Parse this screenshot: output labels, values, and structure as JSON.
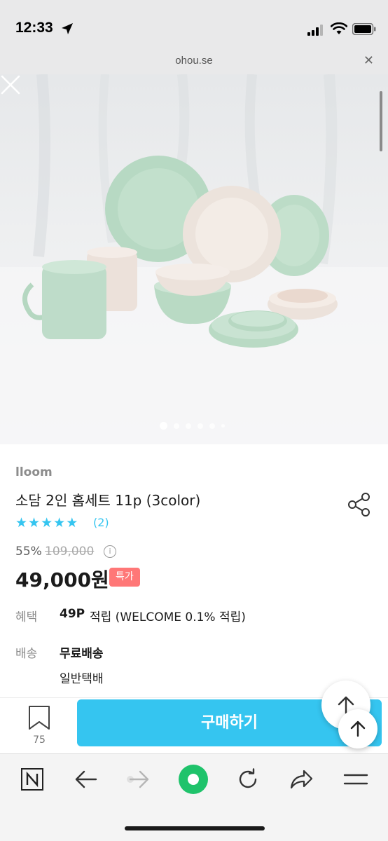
{
  "status_bar": {
    "time": "12:33"
  },
  "browser": {
    "url": "ohou.se"
  },
  "gallery": {
    "image_count": 6,
    "active_index": 0
  },
  "product": {
    "brand": "lloom",
    "title": "소담 2인 홈세트 11p (3color)",
    "rating": 5,
    "review_count": "(2)",
    "discount": "55%",
    "original_price": "109,000",
    "price": "49,000원",
    "badge": "특가"
  },
  "benefit": {
    "label": "혜택",
    "points": "49P",
    "detail": "적립 (WELCOME 0.1% 적립)"
  },
  "shipping": {
    "label": "배송",
    "main": "무료배송",
    "sub": "일반택배"
  },
  "purchase_bar": {
    "bookmark_count": "75",
    "buy_label": "구매하기"
  },
  "colors": {
    "accent": "#35c5f0",
    "badge": "#ff7777",
    "brand_gray": "#8c8c8c"
  }
}
